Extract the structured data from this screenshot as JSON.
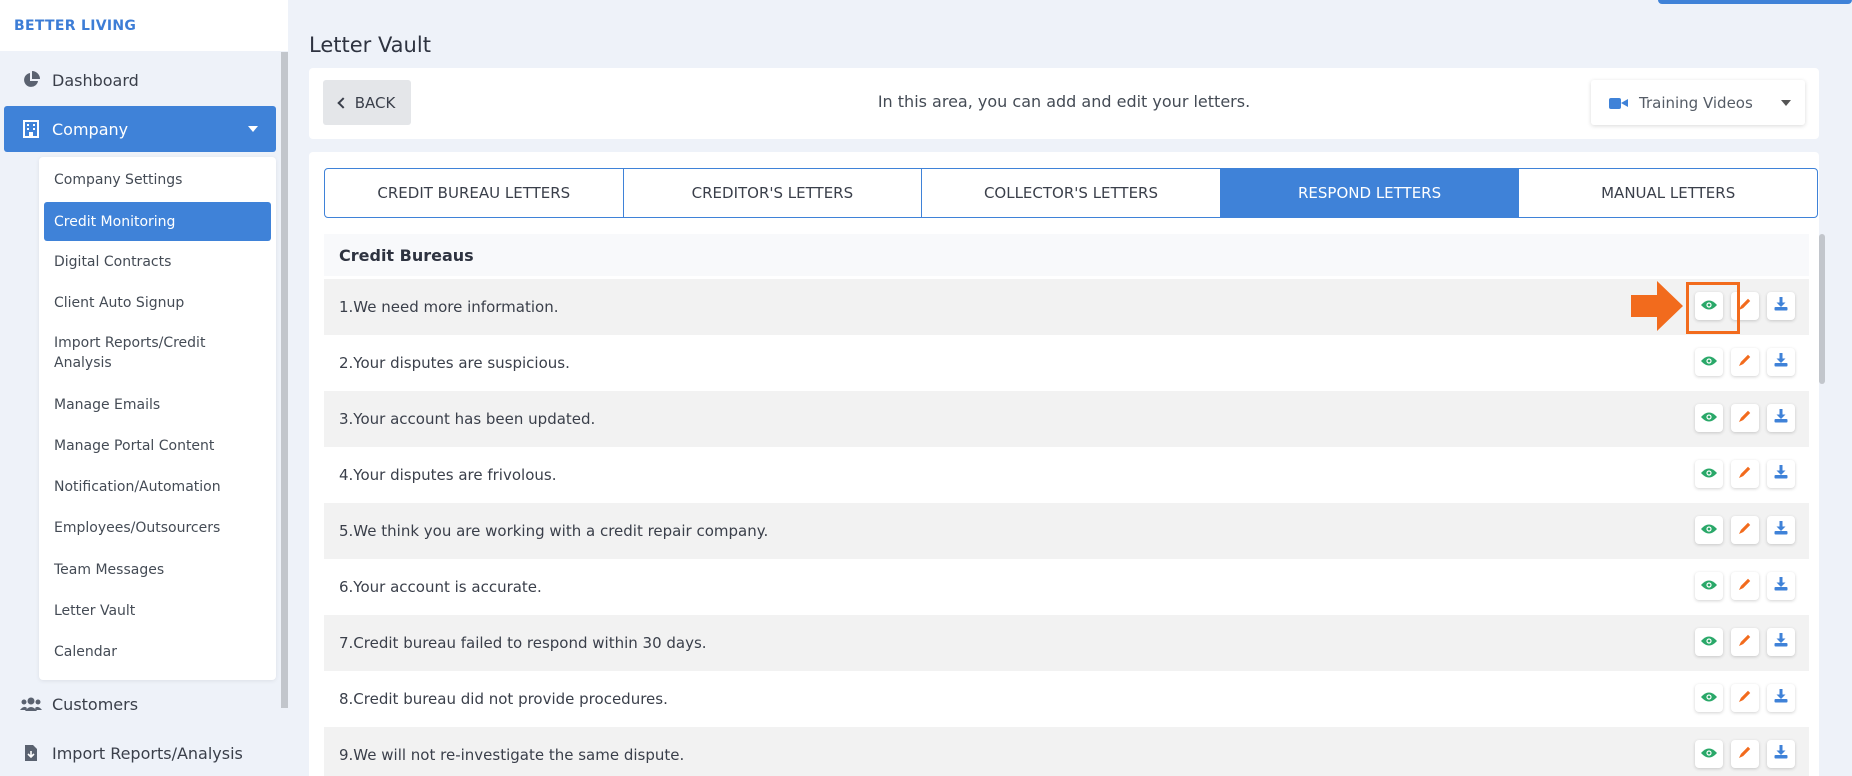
{
  "brand": "BETTER LIVING",
  "sidebar": {
    "items": [
      {
        "label": "Dashboard",
        "icon": "pie-chart-icon"
      },
      {
        "label": "Company",
        "icon": "building-icon",
        "active": true
      },
      {
        "label": "Customers",
        "icon": "users-icon"
      },
      {
        "label": "Import Reports/Analysis",
        "icon": "file-import-icon"
      }
    ],
    "submenu": [
      "Company Settings",
      "Credit Monitoring",
      "Digital Contracts",
      "Client Auto Signup",
      "Import Reports/Credit Analysis",
      "Manage Emails",
      "Manage Portal Content",
      "Notification/Automation",
      "Employees/Outsourcers",
      "Team Messages",
      "Letter Vault",
      "Calendar"
    ],
    "submenu_active": "Credit Monitoring"
  },
  "page": {
    "title": "Letter Vault",
    "back_label": "BACK",
    "description": "In this area, you can add and edit your letters.",
    "training_label": "Training Videos"
  },
  "tabs": [
    {
      "label": "CREDIT BUREAU LETTERS"
    },
    {
      "label": "CREDITOR'S LETTERS"
    },
    {
      "label": "COLLECTOR'S LETTERS"
    },
    {
      "label": "RESPOND LETTERS",
      "active": true
    },
    {
      "label": "MANUAL LETTERS"
    }
  ],
  "section_title": "Credit Bureaus",
  "letters": [
    "1.We need more information.",
    "2.Your disputes are suspicious.",
    "3.Your account has been updated.",
    "4.Your disputes are frivolous.",
    "5.We think you are working with a credit repair company.",
    "6.Your account is accurate.",
    "7.Credit bureau failed to respond within 30 days.",
    "8.Credit bureau did not provide procedures.",
    "9.We will not re-investigate the same dispute."
  ],
  "colors": {
    "accent": "#3f82d8",
    "view": "#2aa869",
    "edit": "#f26b1d",
    "download": "#3f82d8",
    "highlight": "#f26b1d"
  }
}
